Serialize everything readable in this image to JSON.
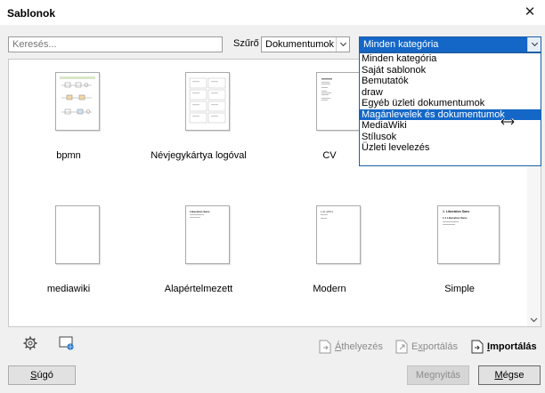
{
  "window": {
    "title": "Sablonok",
    "close_glyph": "✕"
  },
  "search": {
    "placeholder": "Keresés..."
  },
  "filter": {
    "label": "Szűrő",
    "value": "Dokumentumok"
  },
  "category": {
    "value": "Minden kategória",
    "options": [
      "Minden kategória",
      "Saját sablonok",
      "Bemutatók",
      "draw",
      "Egyéb üzleti dokumentumok",
      "Magánlevelek és dokumentumok",
      "MediaWiki",
      "Stílusok",
      "Üzleti levelezés"
    ],
    "highlighted_index": 5
  },
  "templates": [
    {
      "name": "bpmn"
    },
    {
      "name": "Névjegykártya logóval"
    },
    {
      "name": "CV"
    },
    {
      "name": ""
    },
    {
      "name": "mediawiki"
    },
    {
      "name": "Alapértelmezett"
    },
    {
      "name": "Modern"
    },
    {
      "name": "Simple"
    }
  ],
  "thumb_text": {
    "alap_title": "Liberation Sans",
    "modern_title": "CALADEA",
    "simple_h1": "1. Liberation Sans",
    "simple_h2": "1.1 Liberation Sans"
  },
  "toolbar": {
    "move": {
      "pre": "",
      "u": "Á",
      "post": "thelyezés"
    },
    "export": {
      "pre": "E",
      "u": "x",
      "post": "portálás"
    },
    "import": {
      "pre": "",
      "u": "I",
      "post": "mportálás"
    }
  },
  "buttons": {
    "help": {
      "u": "S",
      "rest": "úgó"
    },
    "open": "Megnyitás",
    "cancel": {
      "u": "M",
      "rest": "égse"
    }
  },
  "icons": {
    "settings": "gear-icon",
    "online": "online-templates-icon"
  }
}
